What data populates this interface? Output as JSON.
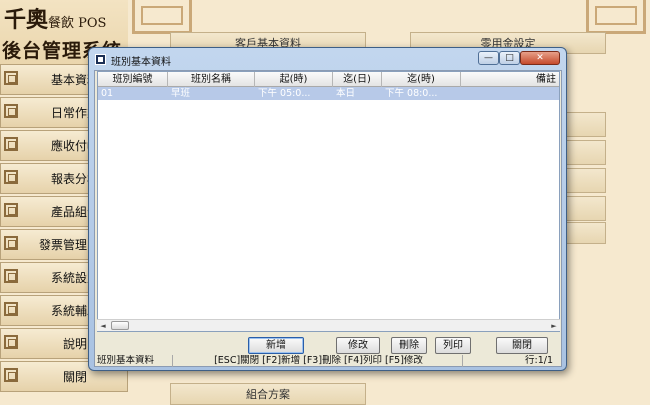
{
  "app": {
    "logo_line1_main": "千奧",
    "logo_line1_sub": "餐飲 POS",
    "logo_line2": "後台管理系統"
  },
  "sidebar": {
    "items": [
      {
        "label": "基本資料"
      },
      {
        "label": "日常作業"
      },
      {
        "label": "應收付帳"
      },
      {
        "label": "報表分析"
      },
      {
        "label": "產品組合"
      },
      {
        "label": "發票管理系統"
      },
      {
        "label": "系統設定"
      },
      {
        "label": "系統輔助"
      },
      {
        "label": "說明"
      },
      {
        "label": "關閉"
      }
    ]
  },
  "background_buttons": {
    "customer": "客戶基本資料",
    "petty_cash": "零用金設定",
    "combo_plan": "組合方案"
  },
  "dialog": {
    "title": "班別基本資料",
    "caption_min": "—",
    "caption_max": "□",
    "caption_close": "✕",
    "columns": [
      "班別編號",
      "班別名稱",
      "起(時)",
      "迄(日)",
      "迄(時)",
      "備註"
    ],
    "rows": [
      [
        "01",
        "早班",
        "下午 05:0...",
        "本日",
        "下午 08:0...",
        ""
      ]
    ],
    "buttons": {
      "add": "新增",
      "edit": "修改",
      "delete": "刪除",
      "print": "列印",
      "close": "關閉"
    },
    "status": {
      "name": "班別基本資料",
      "hotkeys": "[ESC]關閉 [F2]新增 [F3]刪除 [F4]列印 [F5]修改",
      "row": "行:1/1"
    },
    "scroll": {
      "left": "◄",
      "right": "►"
    }
  },
  "colors": {
    "background": "#f6e9cf",
    "selected_row": "#b7c9e8",
    "window_frame": "#a9c2e2",
    "close_button": "#c54a2c"
  }
}
